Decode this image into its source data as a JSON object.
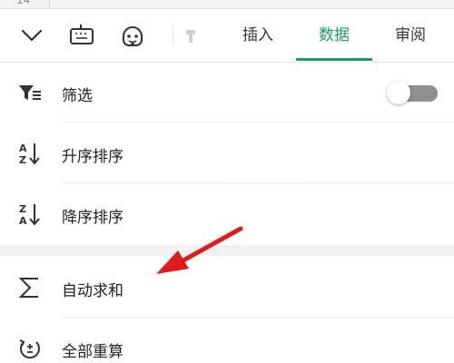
{
  "top_partial": {
    "row_number": "14"
  },
  "toolbar": {
    "icons": {
      "collapse": "chevron-down-icon",
      "keyboard": "keyboard-icon",
      "assistant": "assistant-face-icon",
      "format": "format-icon"
    },
    "tabs": [
      {
        "label": "插入",
        "active": false
      },
      {
        "label": "数据",
        "active": true
      },
      {
        "label": "审阅",
        "active": false
      }
    ],
    "accent_color": "#17a05d"
  },
  "menu": {
    "items": [
      {
        "label": "筛选",
        "icon": "filter-icon",
        "has_toggle": true,
        "toggle_on": false
      },
      {
        "label": "升序排序",
        "icon": "sort-ascending-icon"
      },
      {
        "label": "降序排序",
        "icon": "sort-descending-icon"
      },
      {
        "label": "自动求和",
        "icon": "sigma-icon"
      },
      {
        "label": "全部重算",
        "icon": "recalculate-icon"
      }
    ]
  },
  "annotation": {
    "type": "red-arrow",
    "color": "#e01b1b",
    "points_to": "自动求和"
  }
}
